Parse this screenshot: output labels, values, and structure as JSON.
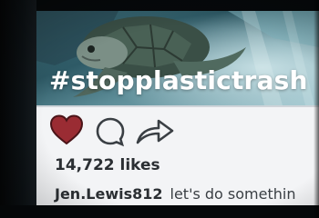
{
  "post": {
    "hashtag": "#stopplastictrash",
    "likes_text": "14,722 likes",
    "username": "Jen.Lewis812",
    "caption": "let's do somethin"
  },
  "colors": {
    "heart": "#9a2c33",
    "ocean": "#3d6e7a",
    "text": "#2b2f33"
  },
  "icons": {
    "like": "heart-icon",
    "comment": "comment-icon",
    "share": "share-icon"
  }
}
